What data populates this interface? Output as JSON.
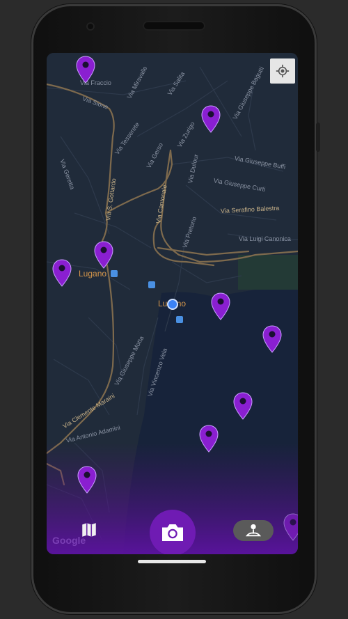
{
  "map": {
    "city_label": "Lugano",
    "city_label_2": "Lugano",
    "streets": {
      "s1": "Via Fraccio",
      "s2": "Via Sione",
      "s3": "Via Miravalle",
      "s4": "Via Salita",
      "s5": "Via Giuseppe Bagutti",
      "s6": "Via Giuseppe Buffi",
      "s7": "Via Giuseppe Curti",
      "s8": "Via Serafino Balestra",
      "s9": "Via Luigi Canonica",
      "s10": "Via Pretorio",
      "s11": "Via Cantonale",
      "s12": "Via S. Gottardo",
      "s13": "Via Geretta",
      "s14": "Via Dufour",
      "s15": "Via Zurigo",
      "s16": "Via Giuseppe Motta",
      "s17": "Via Vincenzo Vela",
      "s18": "Via Clemente Maraini",
      "s19": "Via Antonio Adamini",
      "s20": "Via Tesserete",
      "s21": "Via Gerso"
    },
    "watermark": "Google"
  },
  "controls": {
    "locate_icon": "my-location-icon",
    "map_icon": "map-icon",
    "camera_icon": "camera-icon",
    "profile_icon": "person-pin-icon"
  },
  "colors": {
    "accent": "#6f1bb3",
    "pin": "#8a1fd1",
    "road": "#7e6a4d",
    "water": "#1a2740"
  }
}
